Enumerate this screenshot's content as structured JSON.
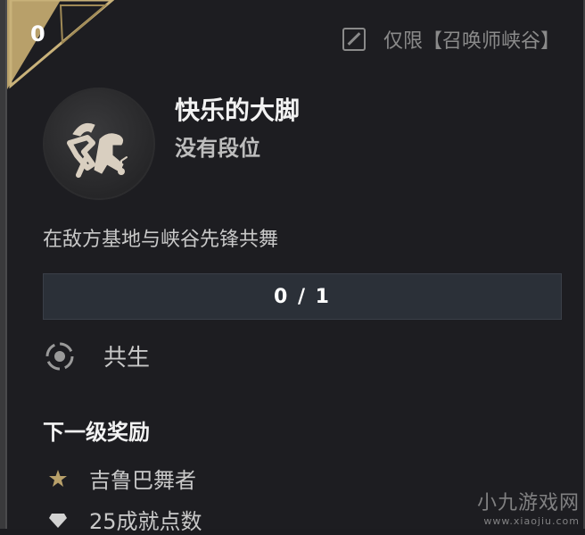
{
  "level": "0",
  "restriction": {
    "icon": "restricted-mode-icon",
    "text": "仅限【召唤师峡谷】"
  },
  "achievement": {
    "icon": "dancing-emblem-icon",
    "title": "快乐的大脚",
    "rank": "没有段位",
    "description": "在敌方基地与峡谷先锋共舞"
  },
  "progress": {
    "text": "0 / 1",
    "value": 0,
    "max": 1
  },
  "category": {
    "icon": "teamwork-icon",
    "label": "共生"
  },
  "rewards": {
    "heading": "下一级奖励",
    "items": [
      {
        "icon": "star-reward-icon",
        "label": "吉鲁巴舞者"
      },
      {
        "icon": "gem-reward-icon",
        "label": "25成就点数"
      }
    ]
  },
  "watermark": {
    "main": "小九游戏网",
    "sub": "www.xiaojiu.com"
  },
  "colors": {
    "gold": "#b8a06a",
    "background": "#1d1d21",
    "progress_bar": "#2b3038",
    "text_primary": "#f2f2f2",
    "text_secondary": "#c8c8c8"
  }
}
